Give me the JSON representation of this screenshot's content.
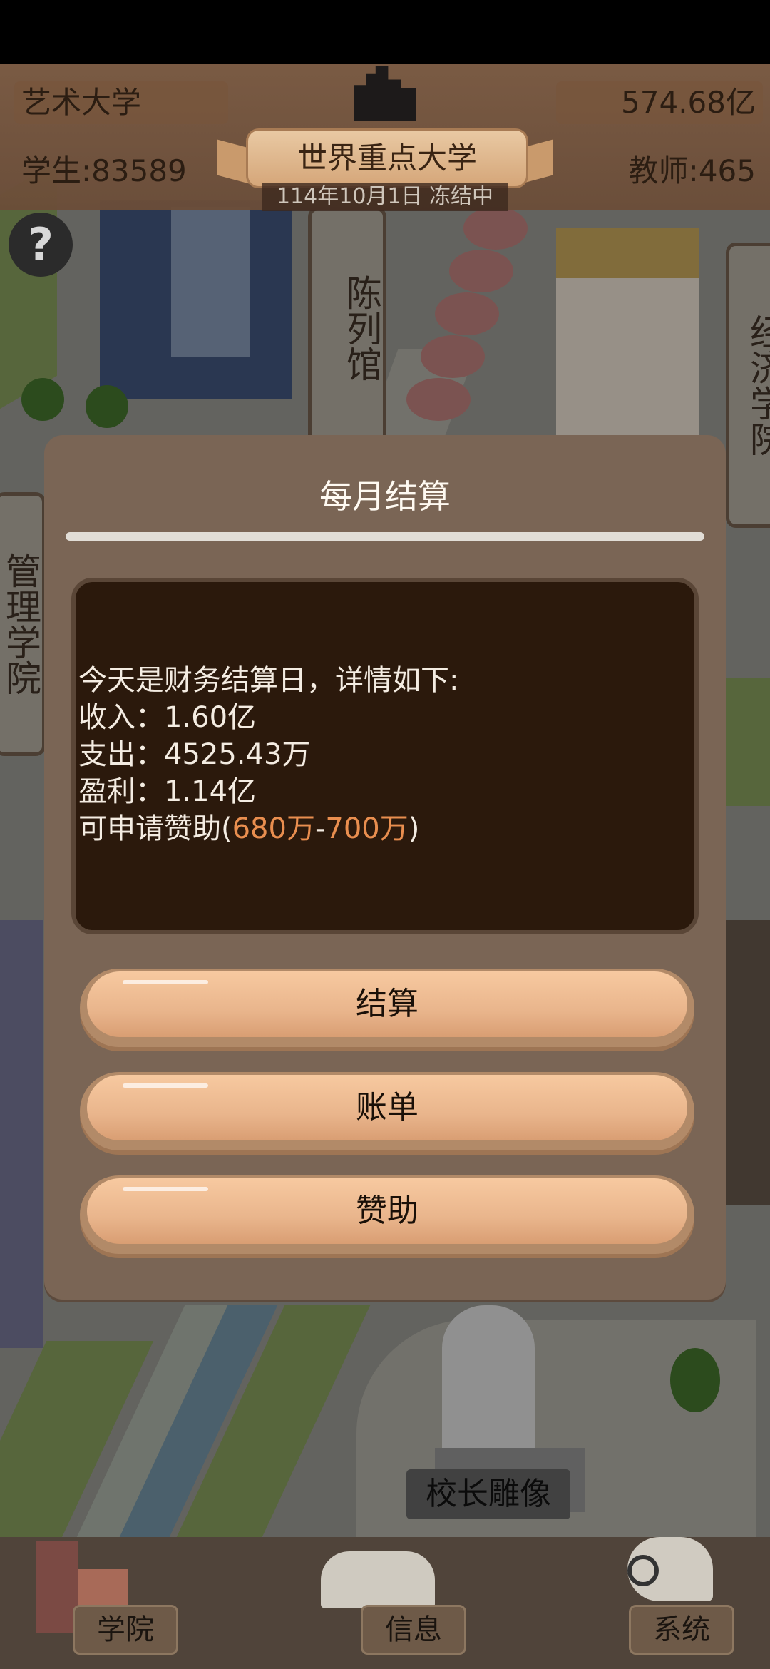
{
  "hud": {
    "school_type": "艺术大学",
    "funds": "574.68亿",
    "students": "学生:83589",
    "teachers": "教师:465",
    "rank_title": "世界重点大学",
    "date_status": "114年10月1日 冻结中",
    "help_icon": "question-icon"
  },
  "map": {
    "signs": {
      "exhibition_hall": "陈列馆",
      "economics_school": "经济学院",
      "management_school": "管理学院"
    },
    "statue_label": "校长雕像"
  },
  "dialog": {
    "title": "每月结算",
    "message": {
      "intro": "今天是财务结算日，详情如下:",
      "income": "收入：1.60亿",
      "expense": "支出：4525.43万",
      "profit": "盈利：1.14亿",
      "sponsor_prefix": "可申请赞助(",
      "sponsor_min": "680万",
      "sponsor_dash": "-",
      "sponsor_max": "700万",
      "sponsor_suffix": ")"
    },
    "buttons": {
      "settle": "结算",
      "bill": "账单",
      "sponsor": "赞助"
    },
    "highlight_color": "#e98e4f"
  },
  "nav": {
    "college": "学院",
    "info": "信息",
    "system": "系统"
  }
}
